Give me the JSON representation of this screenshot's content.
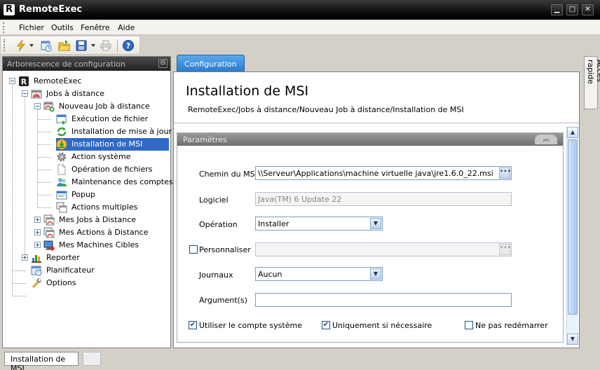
{
  "window": {
    "title": "RemoteExec",
    "app_letter": "R",
    "min": "▁",
    "max": "□",
    "close": "✕"
  },
  "menu": [
    "Fichier",
    "Outils",
    "Fenêtre",
    "Aide"
  ],
  "toolbar": {
    "icons": [
      "lightning-icon",
      "schedule-icon",
      "open-folder-icon",
      "save-icon",
      "print-icon",
      "help-icon"
    ]
  },
  "left_panel": {
    "title": "Arborescence de configuration",
    "pin": "⊟"
  },
  "tree": [
    {
      "label": "RemoteExec"
    },
    {
      "label": "Jobs à distance"
    },
    {
      "label": "Nouveau Job à distance"
    },
    {
      "label": "Exécution de fichier"
    },
    {
      "label": "Installation de mise à jour"
    },
    {
      "label": "Installation de MSI"
    },
    {
      "label": "Action système"
    },
    {
      "label": "Opération de fichiers"
    },
    {
      "label": "Maintenance des comptes…"
    },
    {
      "label": "Popup"
    },
    {
      "label": "Actions multiples"
    },
    {
      "label": "Mes Jobs à Distance"
    },
    {
      "label": "Mes Actions à Distance"
    },
    {
      "label": "Mes Machines Cibles"
    },
    {
      "label": "Reporter"
    },
    {
      "label": "Planificateur"
    },
    {
      "label": "Options"
    }
  ],
  "tab": {
    "label": "Configuration"
  },
  "side_tab": {
    "label": "Accès rapide"
  },
  "header": {
    "title": "Installation de MSI",
    "breadcrumb": "RemoteExec/Jobs à distance/Nouveau Job à distance/Installation de MSI"
  },
  "params": {
    "title": "Paramètres",
    "collapse": "︽",
    "chemin_label": "Chemin du MSI",
    "chemin_value": "\\\\Serveur\\Applications\\machine virtuelle java\\jre1.6.0_22.msi",
    "logiciel_label": "Logiciel",
    "logiciel_value": "Java(TM) 6 Update 22",
    "operation_label": "Opération",
    "operation_value": "Installer",
    "personnaliser_label": "Personnaliser",
    "personnaliser_value": "",
    "journaux_label": "Journaux",
    "journaux_value": "Aucun",
    "argument_label": "Argument(s)",
    "argument_value": "",
    "check1": "Utiliser le compte système",
    "check2": "Uniquement si nécessaire",
    "check3": "Ne pas redémarrer",
    "dots": "•••",
    "dropdown": "▼"
  },
  "status": {
    "tab": "Installation de MSI"
  }
}
